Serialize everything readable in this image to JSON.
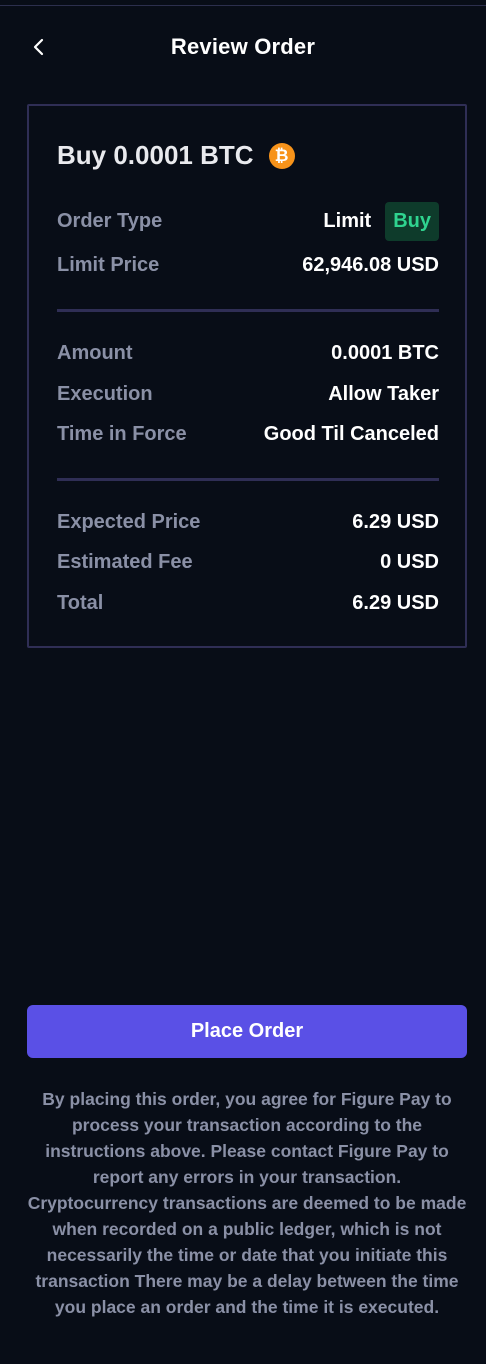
{
  "header": {
    "title": "Review Order",
    "back_icon": "chevron-left-icon"
  },
  "order": {
    "title": "Buy 0.0001 BTC",
    "coin_icon": "bitcoin-icon",
    "coin_symbol": "₿",
    "coin_color": "#f7931a",
    "rows_group1": [
      {
        "label": "Order Type",
        "value": "Limit",
        "badge": "Buy"
      },
      {
        "label": "Limit Price",
        "value": "62,946.08 USD"
      }
    ],
    "rows_group2": [
      {
        "label": "Amount",
        "value": "0.0001 BTC"
      },
      {
        "label": "Execution",
        "value": "Allow Taker"
      },
      {
        "label": "Time in Force",
        "value": "Good Til Canceled"
      }
    ],
    "rows_group3": [
      {
        "label": "Expected Price",
        "value": "6.29 USD"
      },
      {
        "label": "Estimated Fee",
        "value": "0 USD"
      },
      {
        "label": "Total",
        "value": "6.29 USD"
      }
    ]
  },
  "actions": {
    "place_order_label": "Place Order"
  },
  "disclaimer": "By placing this order, you agree for Figure Pay to process your transaction according to the instructions above. Please contact Figure Pay to report any errors in your transaction. Cryptocurrency transactions are deemed to be made when recorded on a public ledger, which is not necessarily the time or date that you initiate this transaction There may be a delay between the time you place an order and the time it is executed.",
  "colors": {
    "background": "#080d17",
    "accent": "#5a50e6",
    "buy_badge_bg": "#0e3b2b",
    "buy_badge_text": "#2fd38f",
    "label": "#8a90a6",
    "border": "#2f2e55"
  }
}
